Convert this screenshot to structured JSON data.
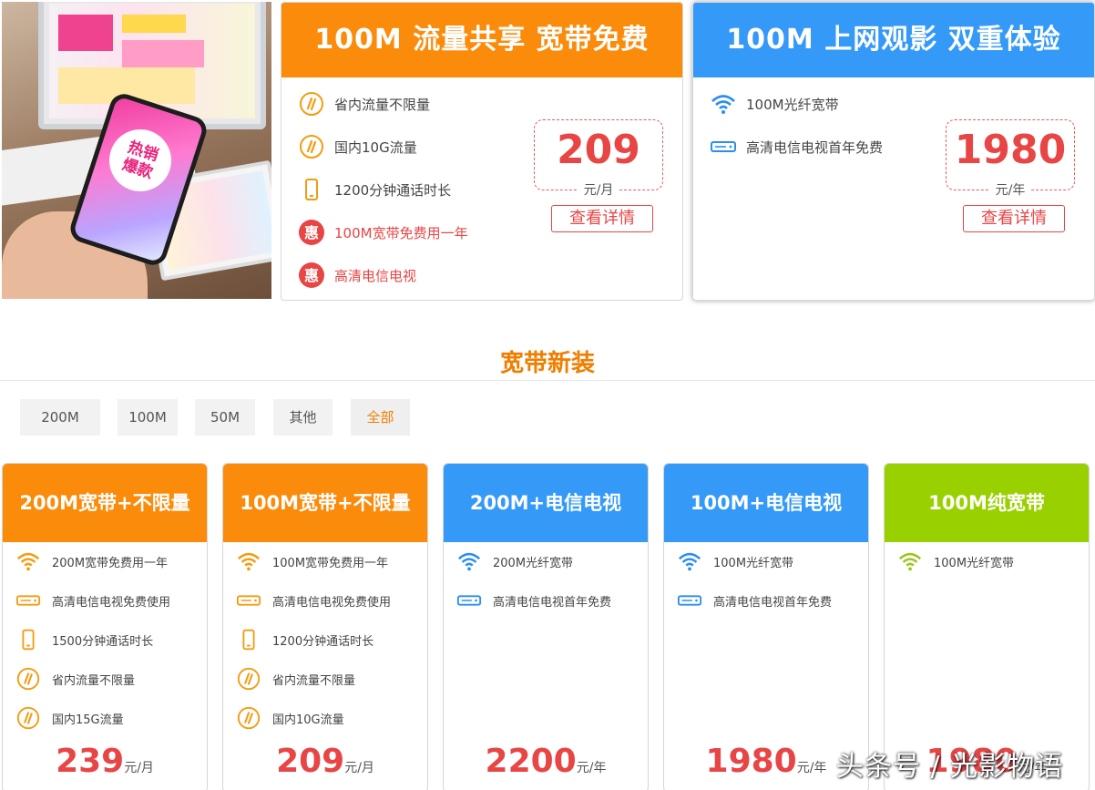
{
  "hero": {
    "badge_line1": "热销",
    "badge_line2": "爆款"
  },
  "top_cards": [
    {
      "title": "100M 流量共享 宽带免费",
      "features": [
        {
          "icon": "data-flow-icon",
          "text": "省内流量不限量"
        },
        {
          "icon": "data-flow-icon",
          "text": "国内10G流量"
        },
        {
          "icon": "phone-icon",
          "text": "1200分钟通话时长"
        },
        {
          "icon": "discount-icon",
          "text": "100M宽带免费用一年"
        },
        {
          "icon": "discount-icon",
          "text": "高清电信电视"
        }
      ],
      "price": "209",
      "unit": "元/月",
      "button": "查看详情"
    },
    {
      "title": "100M 上网观影 双重体验",
      "features": [
        {
          "icon": "wifi-icon",
          "text": "100M光纤宽带"
        },
        {
          "icon": "tv-box-icon",
          "text": "高清电信电视首年免费"
        }
      ],
      "price": "1980",
      "unit": "元/年",
      "button": "查看详情"
    }
  ],
  "section": {
    "title": "宽带新装"
  },
  "filters": [
    "200M",
    "100M",
    "50M",
    "其他",
    "全部"
  ],
  "active_filter": "全部",
  "plans": [
    {
      "title": "200M宽带+不限量",
      "features": [
        "200M宽带免费用一年",
        "高清电信电视免费使用",
        "1500分钟通话时长",
        "省内流量不限量",
        "国内15G流量"
      ],
      "price": "239",
      "unit": "元/月"
    },
    {
      "title": "100M宽带+不限量",
      "features": [
        "100M宽带免费用一年",
        "高清电信电视免费使用",
        "1200分钟通话时长",
        "省内流量不限量",
        "国内10G流量"
      ],
      "price": "209",
      "unit": "元/月"
    },
    {
      "title": "200M+电信电视",
      "features": [
        "200M光纤宽带",
        "高清电信电视首年免费"
      ],
      "price": "2200",
      "unit": "元/年"
    },
    {
      "title": "100M+电信电视",
      "features": [
        "100M光纤宽带",
        "高清电信电视首年免费"
      ],
      "price": "1980",
      "unit": "元/年"
    },
    {
      "title": "100M纯宽带",
      "features": [
        "100M光纤宽带"
      ],
      "price": "1980",
      "unit": "元/年"
    }
  ],
  "watermark": "头条号 / 光影物语",
  "colors": {
    "orange": "#fb8b0b",
    "blue": "#3599f7",
    "green": "#99d100",
    "price_red": "#e84545",
    "section_orange": "#f07e00"
  }
}
